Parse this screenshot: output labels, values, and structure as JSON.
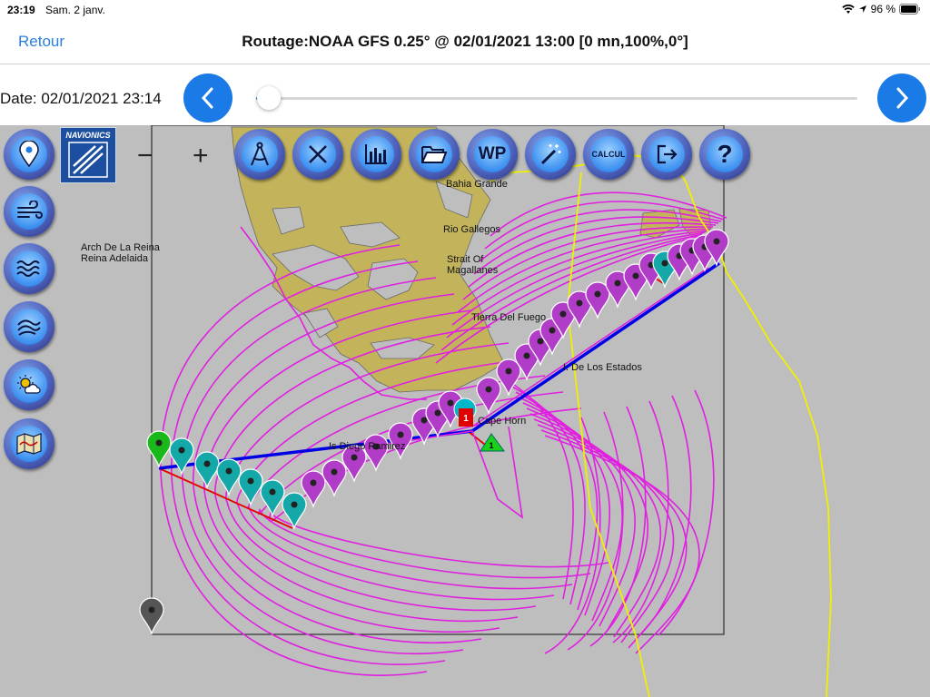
{
  "status": {
    "time": "23:19",
    "date": "Sam. 2 janv.",
    "battery": "96 %"
  },
  "nav": {
    "back_label": "Retour",
    "title": "Routage:NOAA GFS 0.25° @ 02/01/2021 13:00 [0 mn,100%,0°]"
  },
  "timeline": {
    "date_label": "Date: 02/01/2021 23:14",
    "position": 0.02
  },
  "zoom": {
    "minus": "−",
    "plus": "+"
  },
  "toolbar": {
    "navionics": "NAVIONICS",
    "wp": "WP",
    "calcul": "CALCUL",
    "help": "?"
  },
  "labels": {
    "bahia_grande": "Bahia Grande",
    "rio_gallegos": "Rio Gallegos",
    "strait1": "Strait Of",
    "strait2": "Magallanes",
    "arch1": "Arch De La Reina",
    "arch2": "Reina  Adelaida",
    "tierra": "Tierra Del Fuego",
    "estados": "I. De Los Estados",
    "cape": "Cape Horn",
    "diego": "Is Diego Ramirez"
  },
  "markers": {
    "start_badge": "1",
    "target_badge": "1"
  },
  "colors": {
    "accent": "#1b7be6",
    "isochrone": "#e020e0",
    "route": "#0000e6",
    "rhumb": "#e60000",
    "track": "#f0f000",
    "land": "#c3b45c"
  }
}
